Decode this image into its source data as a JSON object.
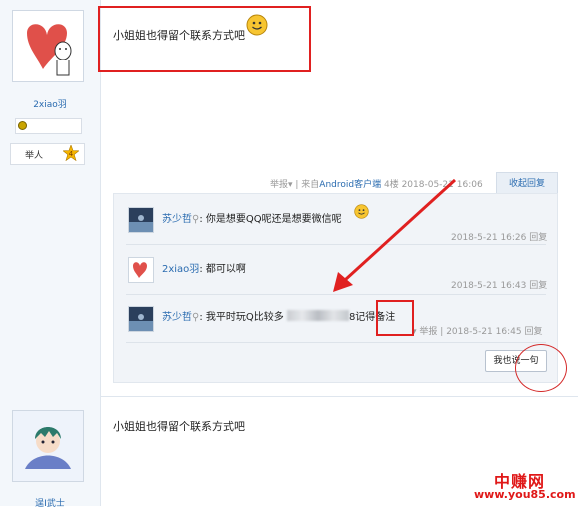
{
  "post1": {
    "username": "2xiao羽",
    "rank_label": "举人",
    "rank_level": "4",
    "message": "小姐姐也得留个联系方式吧",
    "meta_report": "举报▾",
    "meta_source_prefix": " | 来自",
    "meta_source_link": "Android客户端",
    "meta_floor": "4楼",
    "meta_date": "2018-05-21 16:06",
    "collapse_label": "收起回复"
  },
  "replies": [
    {
      "user": "苏少哲",
      "text": ": 你是想要QQ呢还是想要微信呢",
      "time": "2018-5-21 16:26",
      "action": "回复"
    },
    {
      "user": "2xiao羽",
      "text": ": 都可以啊",
      "time": "2018-5-21 16:43",
      "action": "回复"
    },
    {
      "user": "苏少哲",
      "text_before": ": 我平时玩Q比较多",
      "text_after": "8记得备注",
      "report": "举报",
      "time": "2018-5-21 16:45",
      "action": "回复"
    }
  ],
  "say_button": "我也说一句",
  "post2": {
    "username": "逞I武士",
    "message": "小姐姐也得留个联系方式吧"
  },
  "watermark": {
    "name": "中赚网",
    "url": "www.you85.com"
  },
  "colors": {
    "highlight": "#e02020",
    "link": "#2b6cb0"
  }
}
